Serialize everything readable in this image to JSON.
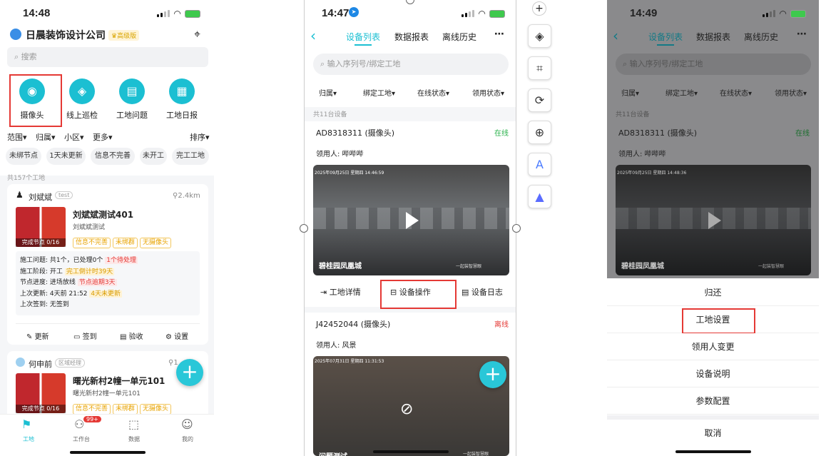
{
  "screen1": {
    "time": "14:48",
    "company": "日晨装饰设计公司",
    "badge": "高级版",
    "search_placeholder": "搜索",
    "quick": [
      {
        "label": "摄像头"
      },
      {
        "label": "线上巡检"
      },
      {
        "label": "工地问题"
      },
      {
        "label": "工地日报"
      }
    ],
    "filters": [
      "范围",
      "归属",
      "小区",
      "更多"
    ],
    "sort": "排序",
    "chips": [
      "未绑节点",
      "1天未更新",
      "信息不完善",
      "未开工",
      "完工工地"
    ],
    "count": "共157个工地",
    "card1": {
      "name": "刘斌斌",
      "role": "test",
      "distance": "2.4km",
      "title": "刘斌斌测试401",
      "sub": "刘斌斌测试",
      "tags": [
        "信息不完善",
        "未绑群",
        "无摄像头"
      ],
      "node": "完成节点 0/16",
      "lines": [
        {
          "k": "施工问题:",
          "v": "共1个，已处理0个",
          "tag": "1个待处理"
        },
        {
          "k": "施工阶段:",
          "v": "开工",
          "tag": "完工倒计时39天"
        },
        {
          "k": "节点进度:",
          "v": "进场放线",
          "tag": "节点逾期3天"
        },
        {
          "k": "上次更新:",
          "v": "4天前 21:52",
          "tag": "4天未更新"
        },
        {
          "k": "上次签到:",
          "v": "无签到",
          "tag": ""
        }
      ],
      "actions": [
        "更新",
        "签到",
        "验收",
        "设置"
      ]
    },
    "card2": {
      "name": "何申前",
      "role": "区域经理",
      "distance": "1",
      "title": "曙光新村2幢一单元101",
      "sub": "曙光新村2幢一单元101",
      "tags": [
        "信息不完善",
        "未绑群",
        "无摄像头"
      ],
      "node": "完成节点 0/16"
    },
    "tabs": [
      {
        "label": "工地"
      },
      {
        "label": "工作台",
        "badge": "99+"
      },
      {
        "label": "数据"
      },
      {
        "label": "我的"
      }
    ]
  },
  "screen2": {
    "time": "14:47",
    "tabs": [
      "设备列表",
      "数据报表",
      "离线历史"
    ],
    "search_placeholder": "输入序列号/绑定工地",
    "filters": [
      "归属",
      "绑定工地",
      "在线状态",
      "领用状态"
    ],
    "count": "共11台设备",
    "dev1": {
      "id": "AD8318311 (摄像头)",
      "status": "在线",
      "owner": "领用人: 哔哔哔",
      "stamp": "2025年09月25日 星期四 14:46:59",
      "site": "碧桂园凤凰城",
      "brand": "一起装智慧眼"
    },
    "actions": [
      "工地详情",
      "设备操作",
      "设备日志"
    ],
    "dev2": {
      "id": "J42452044 (摄像头)",
      "status": "离线",
      "owner": "领用人: 风景",
      "stamp": "2025年07月31日 星期四 11:31:53",
      "site": "问题测试",
      "brand": "一起装智慧眼"
    }
  },
  "screen3": {
    "time": "14:49",
    "tabs": [
      "设备列表",
      "数据报表",
      "离线历史"
    ],
    "search_placeholder": "输入序列号/绑定工地",
    "filters": [
      "归属",
      "绑定工地",
      "在线状态",
      "领用状态"
    ],
    "count": "共11台设备",
    "dev1": {
      "id": "AD8318311 (摄像头)",
      "status": "在线",
      "owner": "领用人: 哔哔哔",
      "stamp": "2025年09月25日 星期四 14:48:36",
      "site": "碧桂园凤凰城",
      "brand": "一起装智慧眼"
    },
    "menu": [
      "归还",
      "工地设置",
      "领用人变更",
      "设备说明",
      "参数配置"
    ],
    "cancel": "取消"
  },
  "colors": {
    "accent": "#1bbfd2",
    "online": "#2bb24c",
    "offline": "#e53935",
    "highlight": "#e53935"
  }
}
